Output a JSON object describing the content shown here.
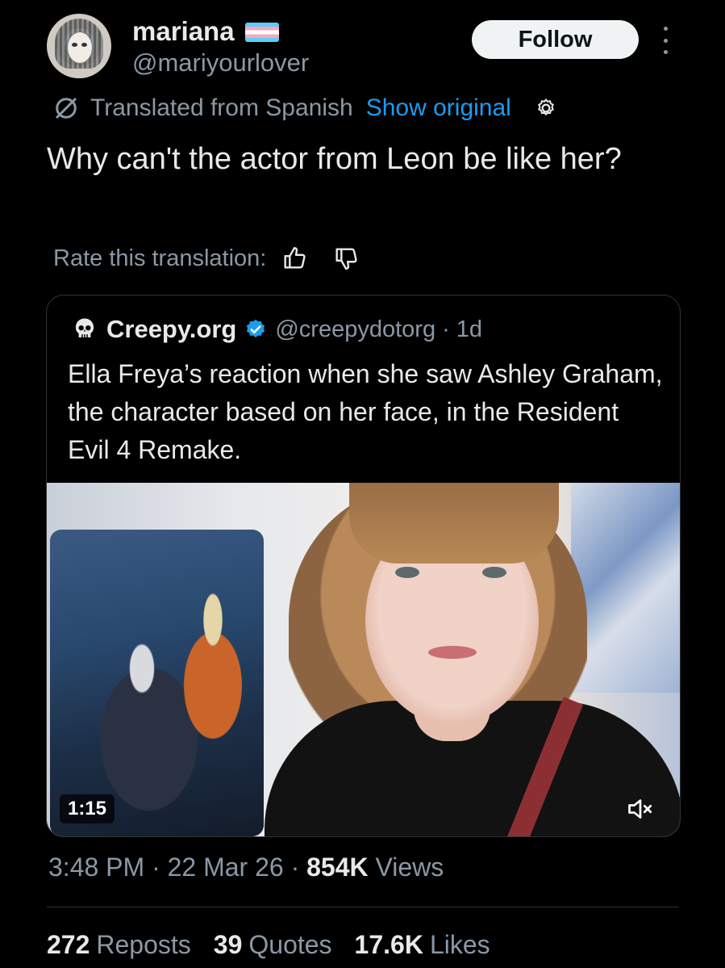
{
  "author": {
    "display_name": "mariana",
    "handle": "@mariyourlover",
    "flag_colors": [
      "#5bcefa",
      "#f5a9b8",
      "#ffffff"
    ]
  },
  "actions": {
    "follow_label": "Follow"
  },
  "translation": {
    "label": "Translated from Spanish",
    "show_original": "Show original",
    "rate_label": "Rate this translation:"
  },
  "tweet": {
    "text": "Why can't the actor from Leon be like her?"
  },
  "quote": {
    "name": "Creepy.org",
    "handle": "@creepydotorg",
    "separator": "·",
    "time": "1d",
    "text": "Ella Freya’s reaction when she saw Ashley Graham, the character based on her face, in the Resident Evil 4 Remake.",
    "video_duration": "1:15"
  },
  "meta": {
    "time": "3:48 PM",
    "sep1": "·",
    "date": "22 Mar 26",
    "sep2": "·",
    "views_count": "854K",
    "views_label": "Views"
  },
  "stats": [
    {
      "count": "272",
      "label": "Reposts"
    },
    {
      "count": "39",
      "label": "Quotes"
    },
    {
      "count": "17.6K",
      "label": "Likes"
    }
  ],
  "colors": {
    "background": "#000000",
    "text": "#e7e9ea",
    "secondary": "#8b98a5",
    "link": "#1d9bf0",
    "verified": "#1d9bf0"
  }
}
